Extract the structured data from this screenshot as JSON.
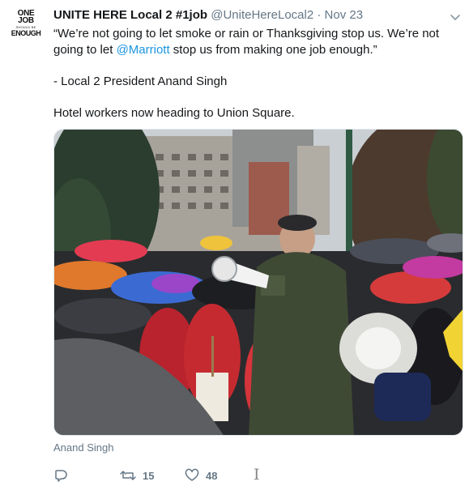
{
  "tweet": {
    "avatar_text": [
      "ONE",
      "JOB",
      "SHOULD BE",
      "ENOUGH"
    ],
    "display_name": "UNITE HERE Local 2 #1job",
    "handle": "@UniteHereLocal2",
    "separator": "·",
    "date": "Nov 23",
    "text": {
      "line1_start": "“We’re not going to let smoke or rain or Thanksgiving stop us. We’re not going to let ",
      "mention": "@Marriott",
      "line1_end": " stop us from making one job enough.”",
      "attribution": "- Local 2 President Anand Singh",
      "closing": "Hotel workers now heading to Union Square."
    },
    "media_caption": "Anand Singh",
    "actions": {
      "reply": {
        "icon": "reply-icon",
        "count": ""
      },
      "retweet": {
        "icon": "retweet-icon",
        "count": "15"
      },
      "like": {
        "icon": "heart-icon",
        "count": "48"
      }
    },
    "colors": {
      "link": "#1b95e0",
      "muted": "#657786",
      "text": "#14171a"
    }
  }
}
